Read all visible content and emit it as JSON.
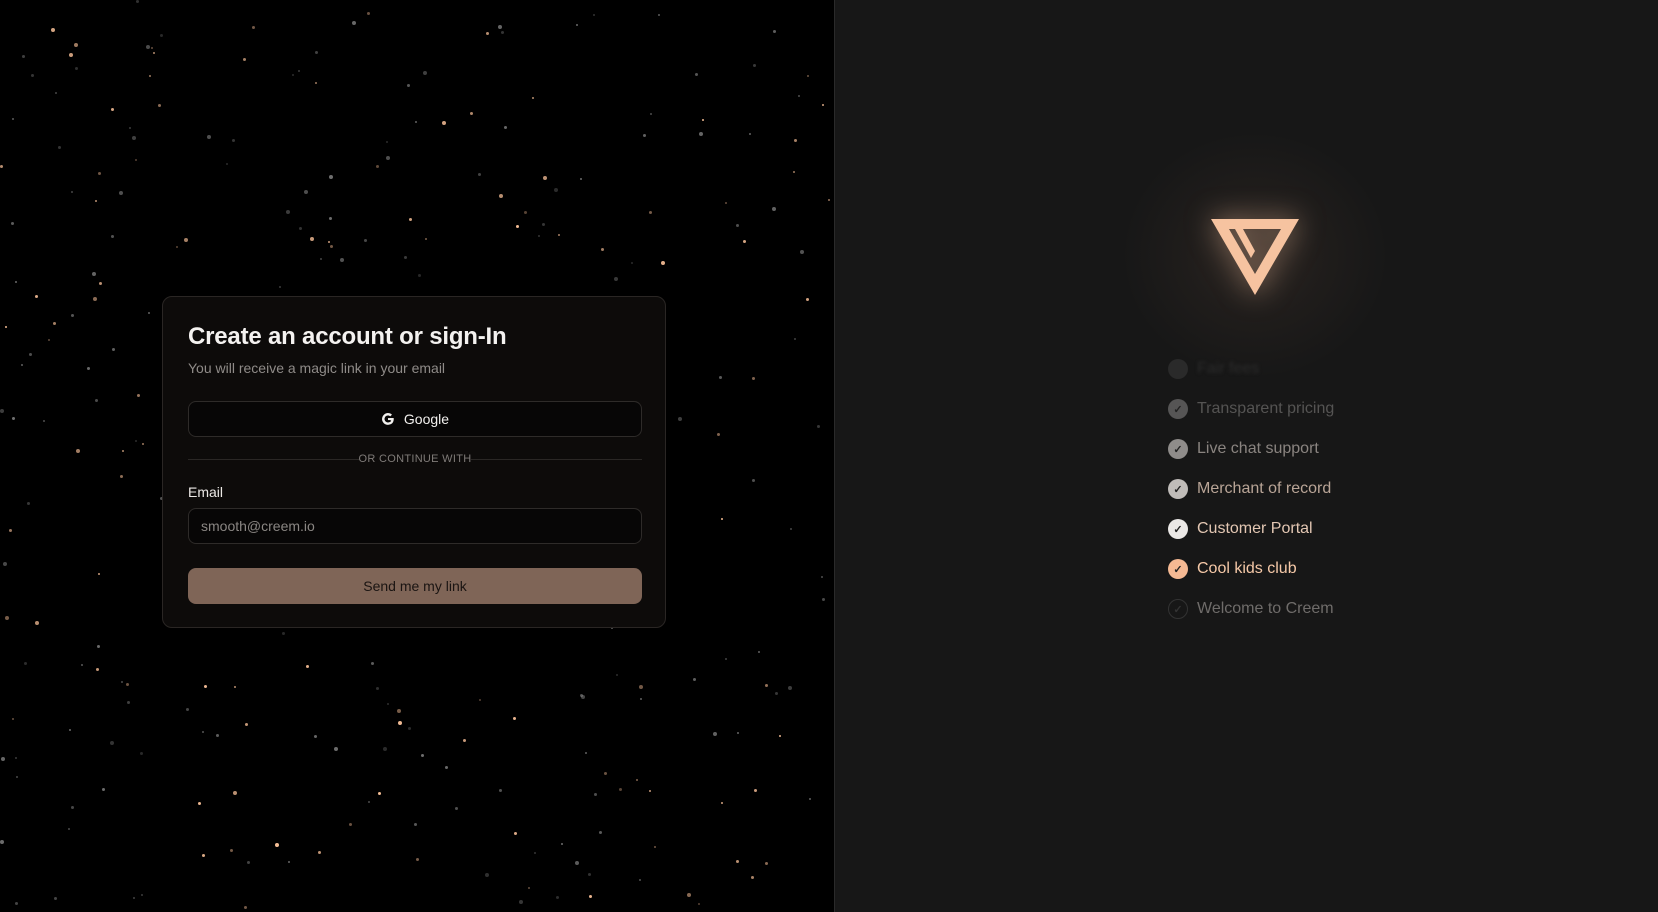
{
  "colors": {
    "accent": "#f6c3a0",
    "button": "#7f6557",
    "left_bg": "#000000",
    "right_bg": "#171717"
  },
  "card": {
    "title": "Create an account or sign-In",
    "subtitle": "You will receive a magic link in your email",
    "google_label": "Google",
    "google_icon": "google-g-icon",
    "divider_text": "OR CONTINUE WITH",
    "email_label": "Email",
    "email_placeholder": "smooth@creem.io",
    "submit_label": "Send me my link"
  },
  "brand": {
    "logo_icon": "creem-triangle-logo"
  },
  "features": [
    {
      "label": "Fair fees",
      "state": "faded-out",
      "color": "#2b2b2b",
      "check_bg": "#2a2a2a"
    },
    {
      "label": "Transparent pricing",
      "state": "dim",
      "color": "#555453",
      "check_bg": "#565555"
    },
    {
      "label": "Live chat support",
      "state": "mid",
      "color": "#8a8480",
      "check_bg": "#8f8c8a"
    },
    {
      "label": "Merchant of record",
      "state": "bright",
      "color": "#b9a597",
      "check_bg": "#c0bcb9"
    },
    {
      "label": "Customer Portal",
      "state": "brighter",
      "color": "#e3c7b3",
      "check_bg": "#ebe8e6"
    },
    {
      "label": "Cool kids club",
      "state": "active",
      "color": "#f6c9a8",
      "check_bg": "#f5b993"
    },
    {
      "label": "Welcome to Creem",
      "state": "upcoming",
      "color": "#6f6c6a",
      "check_bg": "transparent"
    }
  ]
}
